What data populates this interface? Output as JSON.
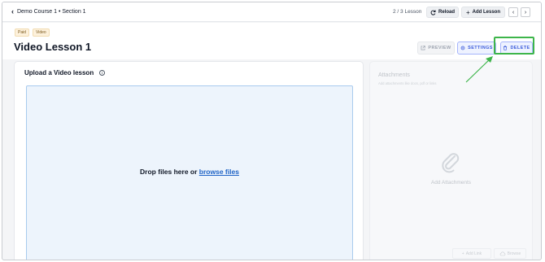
{
  "topbar": {
    "breadcrumb": "Demo Course 1 • Section 1",
    "lesson_count": "2 / 3 Lesson",
    "reload_label": "Reload",
    "add_lesson_label": "Add Lesson"
  },
  "header": {
    "badges": [
      "Paid",
      "Video"
    ],
    "title": "Video Lesson 1",
    "preview_label": "PREVIEW",
    "settings_label": "SETTINGS",
    "delete_label": "DELETE"
  },
  "upload": {
    "title": "Upload a Video lesson",
    "drop_text": "Drop files here or ",
    "browse_link": "browse files"
  },
  "attachments": {
    "title": "Attachments",
    "subtitle": "Add attachments like docs, pdf or links",
    "empty_label": "Add Attachments",
    "add_link_label": "Add Link",
    "browse_label": "Browse"
  },
  "colors": {
    "accent": "#3b5bdb",
    "annotation": "#3db54a",
    "dropzone_bg": "#edf4fc",
    "link": "#1f63c6"
  },
  "icons": [
    "chevron-left-icon",
    "reload-icon",
    "plus-icon",
    "chevron-right-icon",
    "external-link-icon",
    "gear-icon",
    "trash-icon",
    "info-icon",
    "paperclip-icon",
    "link-icon",
    "cloud-upload-icon"
  ]
}
